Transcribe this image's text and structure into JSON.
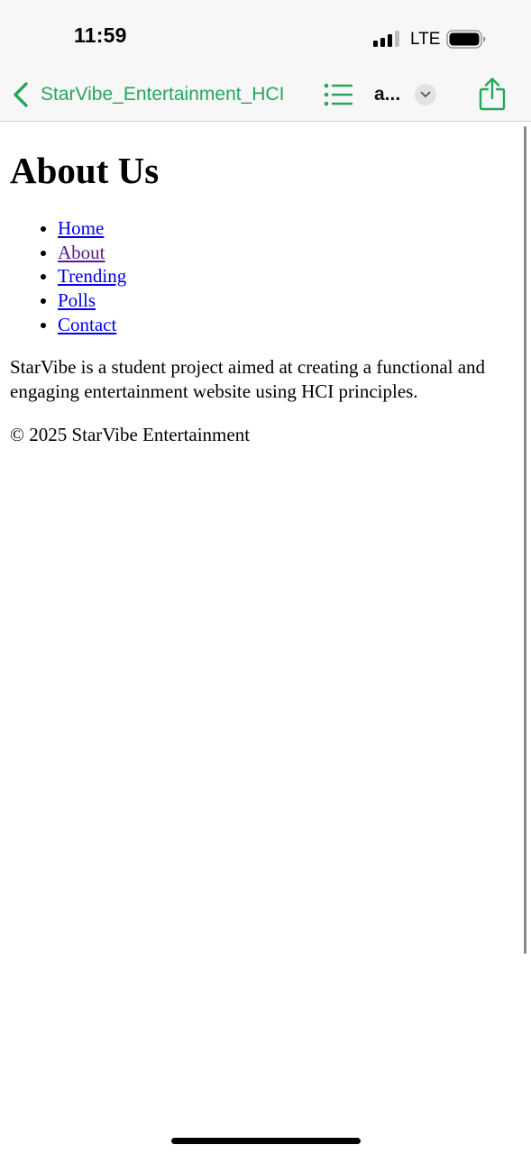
{
  "status_bar": {
    "time": "11:59",
    "network": "LTE",
    "signal_icon": "cellular-signal-icon",
    "battery_icon": "battery-icon"
  },
  "nav_bar": {
    "back_label": "StarVibe_Entertainment_HCI",
    "doc_title": "a...",
    "back_icon": "chevron-left-icon",
    "list_icon": "list-icon",
    "dropdown_icon": "chevron-down-icon",
    "share_icon": "share-icon",
    "accent_color": "#26a65b"
  },
  "page": {
    "heading": "About Us",
    "nav_items": [
      {
        "label": "Home"
      },
      {
        "label": "About"
      },
      {
        "label": "Trending"
      },
      {
        "label": "Polls"
      },
      {
        "label": "Contact"
      }
    ],
    "paragraph": "StarVibe is a student project aimed at creating a functional and engaging entertainment website using HCI principles.",
    "footer": "© 2025 StarVibe Entertainment",
    "link_color": "#0000ee",
    "visited_link_color": "#551a8b"
  }
}
